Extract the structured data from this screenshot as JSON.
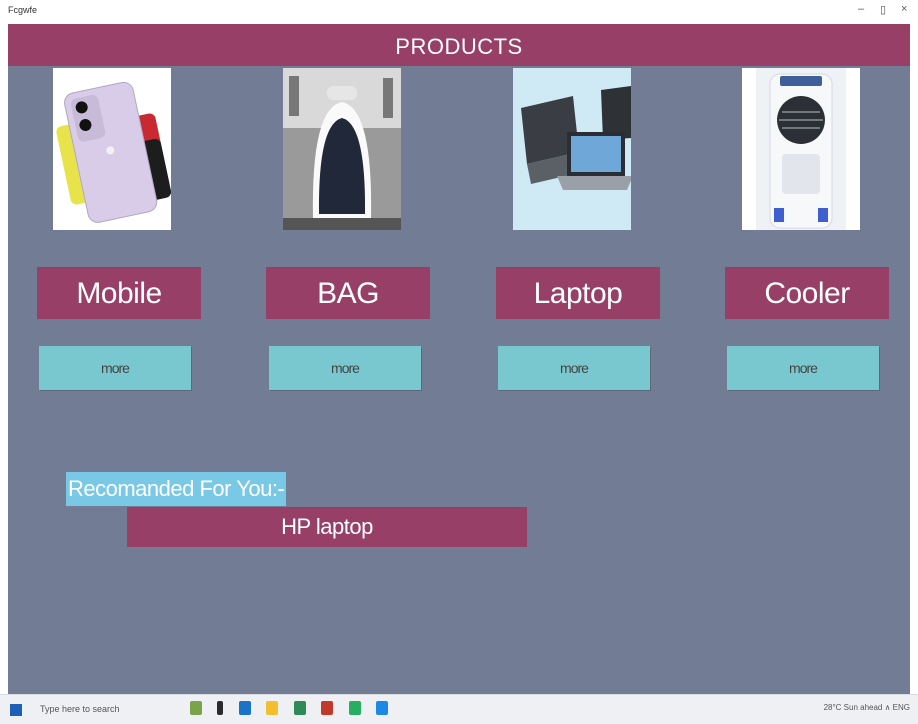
{
  "window": {
    "title": "Fcgwfe"
  },
  "header": {
    "title": "PRODUCTS"
  },
  "products": [
    {
      "label": "Mobile",
      "more": "more",
      "image": "mobile-phone-image"
    },
    {
      "label": "BAG",
      "more": "more",
      "image": "backpack-image"
    },
    {
      "label": "Laptop",
      "more": "more",
      "image": "laptop-image"
    },
    {
      "label": "Cooler",
      "more": "more",
      "image": "air-cooler-image"
    }
  ],
  "recommendation": {
    "label": "Recomanded For You:-",
    "value": "HP laptop"
  },
  "taskbar": {
    "search_placeholder": "Type here to search",
    "tray_text": "28°C  Sun ahead  ∧  ENG"
  },
  "colors": {
    "background": "#737c95",
    "accent": "#973f67",
    "button": "#79c8d0",
    "highlight": "#79c8e6"
  }
}
